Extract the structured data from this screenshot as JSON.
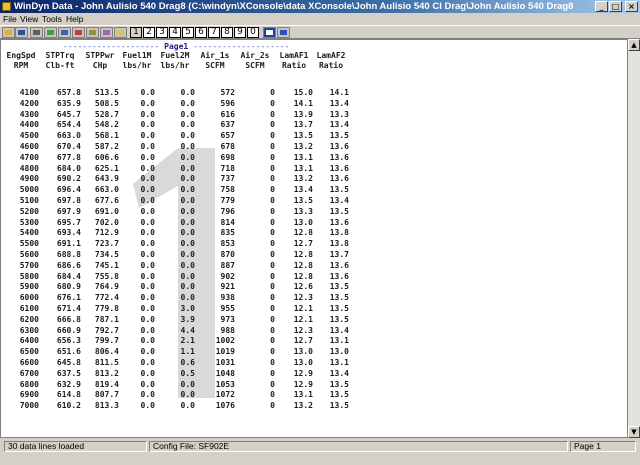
{
  "window": {
    "title": "WinDyn Data - John Aulisio 540 Drag8  (C:\\windyn\\XConsole\\data XConsole\\John Aulisio 540 CI Drag\\John Aulisio 540 Drag8.sfd)"
  },
  "window_controls": {
    "minimize": "_",
    "maximize": "□",
    "close": "×"
  },
  "menu": [
    {
      "label": "File"
    },
    {
      "label": "View"
    },
    {
      "label": "Tools"
    },
    {
      "label": "Help"
    }
  ],
  "toolbar": {
    "pages": [
      "1",
      "2",
      "3",
      "4",
      "5",
      "6",
      "7",
      "8",
      "9",
      "0"
    ],
    "active_page": "1"
  },
  "report": {
    "page_label": "Page1",
    "dashes_left": "--------------------",
    "dashes_right": "--------------------",
    "watermark": "1",
    "headers_line1": [
      "EngSpd",
      "STPTrq",
      "STPPwr",
      "Fuel1M",
      "Fuel2M",
      "Air_1s",
      "Air_2s",
      "LamAF1",
      "LamAF2"
    ],
    "headers_line2": [
      "RPM",
      "Clb-ft",
      "CHp",
      "lbs/hr",
      "lbs/hr",
      "SCFM",
      "SCFM",
      "Ratio",
      "Ratio"
    ],
    "rows": [
      [
        "4100",
        "657.8",
        "513.5",
        "0.0",
        "0.0",
        "572",
        "0",
        "15.0",
        "14.1"
      ],
      [
        "4200",
        "635.9",
        "508.5",
        "0.0",
        "0.0",
        "596",
        "0",
        "14.1",
        "13.4"
      ],
      [
        "4300",
        "645.7",
        "528.7",
        "0.0",
        "0.0",
        "616",
        "0",
        "13.9",
        "13.3"
      ],
      [
        "4400",
        "654.4",
        "548.2",
        "0.0",
        "0.0",
        "637",
        "0",
        "13.7",
        "13.4"
      ],
      [
        "4500",
        "663.0",
        "568.1",
        "0.0",
        "0.0",
        "657",
        "0",
        "13.5",
        "13.5"
      ],
      [
        "4600",
        "670.4",
        "587.2",
        "0.0",
        "0.0",
        "678",
        "0",
        "13.2",
        "13.6"
      ],
      [
        "4700",
        "677.8",
        "606.6",
        "0.0",
        "0.0",
        "698",
        "0",
        "13.1",
        "13.6"
      ],
      [
        "4800",
        "684.0",
        "625.1",
        "0.0",
        "0.0",
        "718",
        "0",
        "13.1",
        "13.6"
      ],
      [
        "4900",
        "690.2",
        "643.9",
        "0.0",
        "0.0",
        "737",
        "0",
        "13.2",
        "13.6"
      ],
      [
        "5000",
        "696.4",
        "663.0",
        "0.0",
        "0.0",
        "758",
        "0",
        "13.4",
        "13.5"
      ],
      [
        "5100",
        "697.8",
        "677.6",
        "0.0",
        "0.0",
        "779",
        "0",
        "13.5",
        "13.4"
      ],
      [
        "5200",
        "697.9",
        "691.0",
        "0.0",
        "0.0",
        "796",
        "0",
        "13.3",
        "13.5"
      ],
      [
        "5300",
        "695.7",
        "702.0",
        "0.0",
        "0.0",
        "814",
        "0",
        "13.0",
        "13.6"
      ],
      [
        "5400",
        "693.4",
        "712.9",
        "0.0",
        "0.0",
        "835",
        "0",
        "12.8",
        "13.8"
      ],
      [
        "5500",
        "691.1",
        "723.7",
        "0.0",
        "0.0",
        "853",
        "0",
        "12.7",
        "13.8"
      ],
      [
        "5600",
        "688.8",
        "734.5",
        "0.0",
        "0.0",
        "870",
        "0",
        "12.8",
        "13.7"
      ],
      [
        "5700",
        "686.6",
        "745.1",
        "0.0",
        "0.0",
        "887",
        "0",
        "12.8",
        "13.6"
      ],
      [
        "5800",
        "684.4",
        "755.8",
        "0.0",
        "0.0",
        "902",
        "0",
        "12.8",
        "13.6"
      ],
      [
        "5900",
        "680.9",
        "764.9",
        "0.0",
        "0.0",
        "921",
        "0",
        "12.6",
        "13.5"
      ],
      [
        "6000",
        "676.1",
        "772.4",
        "0.0",
        "0.0",
        "938",
        "0",
        "12.3",
        "13.5"
      ],
      [
        "6100",
        "671.4",
        "779.8",
        "0.0",
        "3.0",
        "955",
        "0",
        "12.1",
        "13.5"
      ],
      [
        "6200",
        "666.8",
        "787.1",
        "0.0",
        "3.9",
        "973",
        "0",
        "12.1",
        "13.5"
      ],
      [
        "6300",
        "660.9",
        "792.7",
        "0.0",
        "4.4",
        "988",
        "0",
        "12.3",
        "13.4"
      ],
      [
        "6400",
        "656.3",
        "799.7",
        "0.0",
        "2.1",
        "1002",
        "0",
        "12.7",
        "13.1"
      ],
      [
        "6500",
        "651.6",
        "806.4",
        "0.0",
        "1.1",
        "1019",
        "0",
        "13.0",
        "13.0"
      ],
      [
        "6600",
        "645.8",
        "811.5",
        "0.0",
        "0.6",
        "1031",
        "0",
        "13.0",
        "13.1"
      ],
      [
        "6700",
        "637.5",
        "813.2",
        "0.0",
        "0.5",
        "1048",
        "0",
        "12.9",
        "13.4"
      ],
      [
        "6800",
        "632.9",
        "819.4",
        "0.0",
        "0.0",
        "1053",
        "0",
        "12.9",
        "13.5"
      ],
      [
        "6900",
        "614.8",
        "807.7",
        "0.0",
        "0.0",
        "1072",
        "0",
        "13.1",
        "13.5"
      ],
      [
        "7000",
        "610.2",
        "813.3",
        "0.0",
        "0.0",
        "1076",
        "0",
        "13.2",
        "13.5"
      ]
    ]
  },
  "status": {
    "left": "30 data lines loaded",
    "config": "Config File: SF902E",
    "page": "Page 1"
  }
}
